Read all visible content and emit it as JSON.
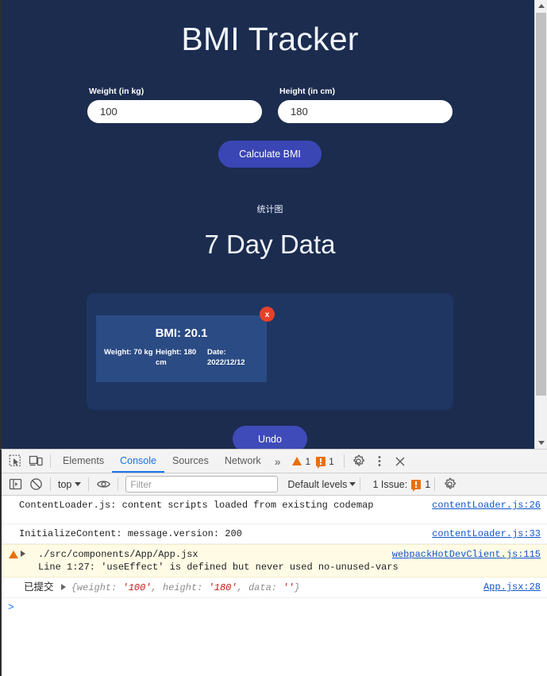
{
  "page": {
    "title": "BMI Tracker",
    "weight_field": {
      "label": "Weight (in kg)",
      "value": "100",
      "placeholder": ""
    },
    "height_field": {
      "label": "Height (in cm)",
      "value": "180",
      "placeholder": ""
    },
    "calculate_button": "Calculate BMI",
    "chart_caption": "统计图",
    "section_title": "7 Day Data",
    "undo_button": "Undo",
    "card": {
      "bmi_title": "BMI: 20.1",
      "weight": "Weight: 70 kg",
      "height": "Height: 180 cm",
      "date": "Date: 2022/12/12",
      "close_label": "x"
    }
  },
  "chart_data": {
    "type": "bar",
    "title": "7 Day Data",
    "subtitle": "统计图",
    "categories": [
      "2022/12/12"
    ],
    "series": [
      {
        "name": "BMI",
        "values": [
          20.1
        ]
      },
      {
        "name": "Weight (kg)",
        "values": [
          70
        ]
      },
      {
        "name": "Height (cm)",
        "values": [
          180
        ]
      }
    ],
    "xlabel": "",
    "ylabel": "",
    "grid": false,
    "legend": "none"
  },
  "devtools": {
    "tabs": [
      {
        "label": "Elements",
        "active": false
      },
      {
        "label": "Console",
        "active": true
      },
      {
        "label": "Sources",
        "active": false
      },
      {
        "label": "Network",
        "active": false
      }
    ],
    "more_tabs_glyph": "»",
    "warning_count": "1",
    "error_count": "1",
    "filterbar": {
      "context": "top",
      "filter_placeholder": "Filter",
      "levels": "Default levels",
      "issues_label": "1 Issue:",
      "issues_count": "1"
    },
    "console_rows": [
      {
        "kind": "log",
        "text": "ContentLoader.js: content scripts loaded from existing codemap",
        "source": "contentLoader.js:26"
      },
      {
        "kind": "log",
        "text": "InitializeContent: message.version: 200",
        "source": "contentLoader.js:33"
      },
      {
        "kind": "warning",
        "text": "./src/components/App/App.jsx",
        "text2": "Line 1:27:  'useEffect' is defined but never used  no-unused-vars",
        "source": "webpackHotDevClient.js:115"
      },
      {
        "kind": "object",
        "label": "已提交",
        "preview_1": "{weight: ",
        "preview_v1": "'100'",
        "preview_2": ", height: ",
        "preview_v2": "'180'",
        "preview_3": ", data: ",
        "preview_v3": "''",
        "preview_4": "}",
        "source": "App.jsx:28"
      }
    ],
    "prompt_caret": ">"
  },
  "colors": {
    "page_background": "#1b2c4f",
    "chart_panel": "#1f3663",
    "card": "#2b4b84",
    "accent_button": "#3b46b5",
    "close_button": "#e8402a",
    "devtools_accent": "#1a73e8",
    "warning": "#e8710a",
    "link": "#1155cc"
  }
}
